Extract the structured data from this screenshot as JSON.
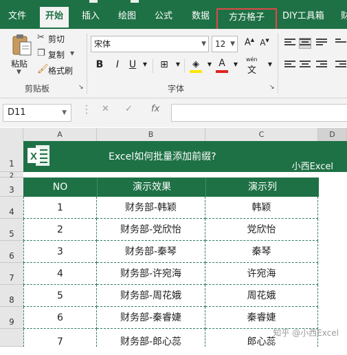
{
  "ribbon_tabs": [
    "文件",
    "开始",
    "插入",
    "绘图",
    "公式",
    "数据",
    "方方格子",
    "DIY工具箱",
    "财"
  ],
  "clipboard": {
    "paste": "粘贴",
    "cut": "剪切",
    "copy": "复制",
    "format_painter": "格式刷",
    "group_label": "剪贴板"
  },
  "font": {
    "name": "宋体",
    "size": "12",
    "group_label": "字体",
    "wen_label": "wén"
  },
  "name_box": "D11",
  "columns": [
    "A",
    "B",
    "C",
    "D"
  ],
  "rows": [
    "1",
    "2",
    "3",
    "4",
    "5",
    "6",
    "7",
    "8",
    "9"
  ],
  "banner": {
    "title": "Excel如何批量添加前缀?",
    "brand": "小西Excel"
  },
  "table": {
    "headers": [
      "NO",
      "演示效果",
      "演示列"
    ],
    "rows": [
      [
        "1",
        "财务部-韩颖",
        "韩颖"
      ],
      [
        "2",
        "财务部-党欣怡",
        "党欣怡"
      ],
      [
        "3",
        "财务部-秦琴",
        "秦琴"
      ],
      [
        "4",
        "财务部-许宛海",
        "许宛海"
      ],
      [
        "5",
        "财务部-周花娥",
        "周花娥"
      ],
      [
        "6",
        "财务部-秦睿婕",
        "秦睿婕"
      ],
      [
        "7",
        "财务部-郎心蕊",
        "郎心蕊"
      ]
    ]
  },
  "watermark": "知乎 @小西Excel",
  "colors": {
    "excel_green": "#1e7145",
    "highlight_red": "#e04848"
  }
}
